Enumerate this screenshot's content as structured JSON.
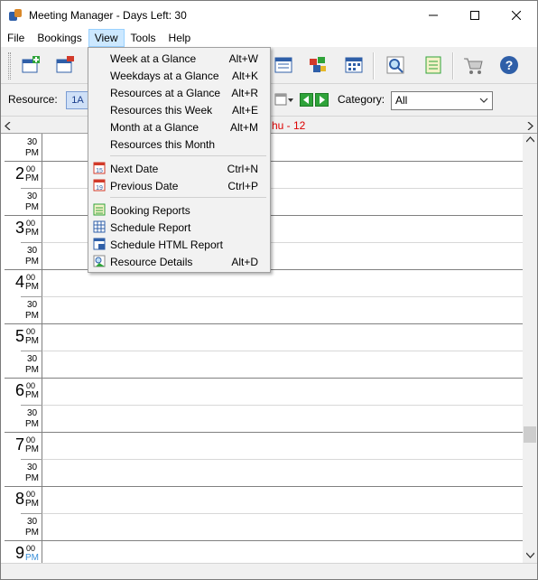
{
  "window": {
    "title": "Meeting Manager - Days Left:  30"
  },
  "menubar": [
    "File",
    "Bookings",
    "View",
    "Tools",
    "Help"
  ],
  "filter": {
    "resource_label": "Resource:",
    "resource_value": "1A",
    "category_label": "Category:",
    "category_value": "All"
  },
  "schedule": {
    "day_header": "hu - 12",
    "first_half": {
      "min": "30",
      "ampm": "PM"
    },
    "hours": [
      {
        "hour": "2",
        "min": "00",
        "ampm": "PM",
        "half_min": "30",
        "half_ampm": "PM"
      },
      {
        "hour": "3",
        "min": "00",
        "ampm": "PM",
        "half_min": "30",
        "half_ampm": "PM"
      },
      {
        "hour": "4",
        "min": "00",
        "ampm": "PM",
        "half_min": "30",
        "half_ampm": "PM"
      },
      {
        "hour": "5",
        "min": "00",
        "ampm": "PM",
        "half_min": "30",
        "half_ampm": "PM"
      },
      {
        "hour": "6",
        "min": "00",
        "ampm": "PM",
        "half_min": "30",
        "half_ampm": "PM"
      },
      {
        "hour": "7",
        "min": "00",
        "ampm": "PM",
        "half_min": "30",
        "half_ampm": "PM"
      },
      {
        "hour": "8",
        "min": "00",
        "ampm": "PM",
        "half_min": "30",
        "half_ampm": "PM"
      },
      {
        "hour": "9",
        "min": "00",
        "ampm": "PM"
      }
    ]
  },
  "view_menu": {
    "group1": [
      {
        "label": "Week at a Glance",
        "shortcut": "Alt+W"
      },
      {
        "label": "Weekdays at a Glance",
        "shortcut": "Alt+K"
      },
      {
        "label": "Resources at a Glance",
        "shortcut": "Alt+R"
      },
      {
        "label": "Resources this Week",
        "shortcut": "Alt+E"
      },
      {
        "label": "Month at a Glance",
        "shortcut": "Alt+M"
      },
      {
        "label": "Resources this Month",
        "shortcut": ""
      }
    ],
    "group2": [
      {
        "label": "Next Date",
        "shortcut": "Ctrl+N",
        "icon": "calendar-15-icon"
      },
      {
        "label": "Previous Date",
        "shortcut": "Ctrl+P",
        "icon": "calendar-19-icon"
      }
    ],
    "group3": [
      {
        "label": "Booking Reports",
        "shortcut": "",
        "icon": "report-icon"
      },
      {
        "label": "Schedule Report",
        "shortcut": "",
        "icon": "grid-icon"
      },
      {
        "label": "Schedule HTML Report",
        "shortcut": "",
        "icon": "html-report-icon"
      },
      {
        "label": "Resource Details",
        "shortcut": "Alt+D",
        "icon": "resource-details-icon"
      }
    ]
  },
  "colors": {
    "accent": "#2f5fa8",
    "highlight": "#cce8ff",
    "date_red": "#dd0000",
    "nav_green": "#2fa33a"
  }
}
